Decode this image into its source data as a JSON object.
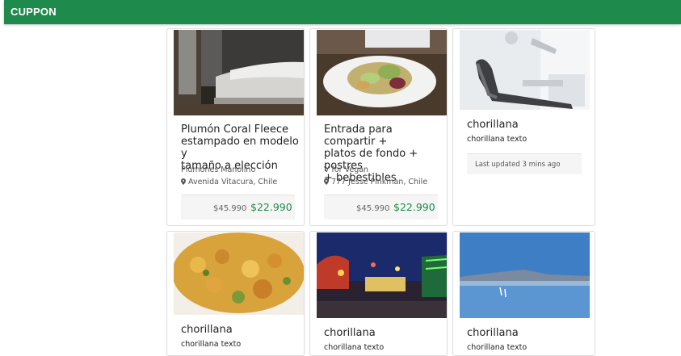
{
  "navbar": {
    "brand": "CUPPON"
  },
  "cards": [
    {
      "image_icon": "bedroom-photo",
      "title_line1": "Plumón Coral Fleece",
      "title_line2": "estampado en modelo y",
      "title_line3": "tamaño a elección",
      "merchant": "Plumones Manolino",
      "location": "Avenida Vitacura, Chile",
      "old_price": "$45.990",
      "new_price": "$22.990"
    },
    {
      "image_icon": "salad-photo",
      "title_line1": "Entrada para compartir +",
      "title_line2": "platos de fondo + postres",
      "title_line3": "+ bebestibles",
      "merchant": "V for Vegan",
      "location": "777 Jesse Pinkman, Chile",
      "old_price": "$45.990",
      "new_price": "$22.990"
    },
    {
      "image_icon": "dental-chair-photo",
      "title": "chorillana",
      "text": "chorillana texto",
      "updated": "Last updated 3 mins ago"
    },
    {
      "image_icon": "food-photo",
      "title": "chorillana",
      "text": "chorillana texto"
    },
    {
      "image_icon": "carnival-night-photo",
      "title": "chorillana",
      "text": "chorillana texto"
    },
    {
      "image_icon": "lake-landscape-photo",
      "title": "chorillana",
      "text": "chorillana texto"
    }
  ]
}
